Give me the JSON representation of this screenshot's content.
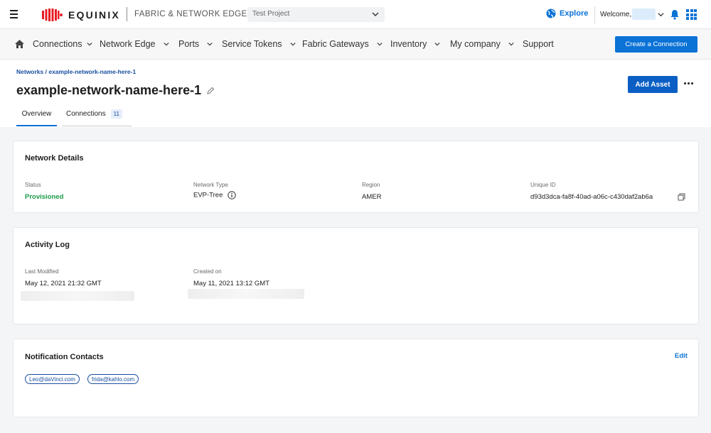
{
  "topbar": {
    "logo_text": "EQUINIX",
    "product_name": "FABRIC & NETWORK EDGE",
    "project_select_value": "Test Project",
    "explore_label": "Explore",
    "welcome_label": "Welcome,",
    "icons": {
      "menu": "hamburger-icon",
      "globe": "globe-icon",
      "bell": "bell-icon",
      "apps": "apps-grid-icon"
    }
  },
  "nav": {
    "items": [
      {
        "label": "Connections"
      },
      {
        "label": "Network Edge"
      },
      {
        "label": "Ports"
      },
      {
        "label": "Service Tokens"
      },
      {
        "label": "Fabric Gateways"
      },
      {
        "label": "Inventory"
      },
      {
        "label": "My company"
      },
      {
        "label": "Support"
      }
    ],
    "create_button": "Create a Connection"
  },
  "page": {
    "breadcrumb": "Networks / example-network-name-here-1",
    "title": "example-network-name-here-1",
    "add_asset_button": "Add Asset",
    "tabs": [
      {
        "label": "Overview",
        "active": true
      },
      {
        "label": "Connections",
        "badge": "11"
      }
    ]
  },
  "network_details": {
    "title": "Network Details",
    "fields": [
      {
        "label": "Status",
        "value": "Provisioned"
      },
      {
        "label": "Network Type",
        "value": "EVP-Tree"
      },
      {
        "label": "Region",
        "value": "AMER"
      },
      {
        "label": "Unique ID",
        "value": "d93d3dca-fa8f-40ad-a06c-c430daf2ab6a"
      }
    ]
  },
  "activity_log": {
    "title": "Activity Log",
    "fields": [
      {
        "label": "Last Modified",
        "value": "May 12, 2021 21:32 GMT"
      },
      {
        "label": "Created on",
        "value": "May 11, 2021 13:12 GMT"
      }
    ]
  },
  "notification_contacts": {
    "title": "Notification Contacts",
    "edit_label": "Edit",
    "contacts": [
      "Leo@daVinci.com",
      "frida@kahlo.com"
    ]
  },
  "colors": {
    "primary_blue": "#0b72d6",
    "status_green": "#1b9a4a",
    "brand_red": "#e91c24"
  }
}
